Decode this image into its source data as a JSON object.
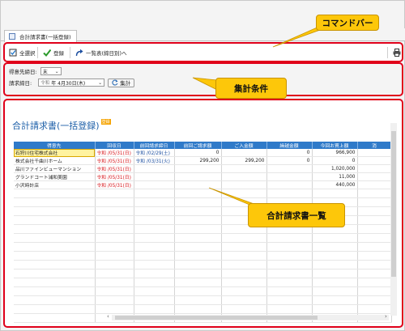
{
  "tab": {
    "label": "合計請求書(一括登録)"
  },
  "toolbar": {
    "select_all": "全選択",
    "register": "登録",
    "list_link": "一覧表(締日別)へ"
  },
  "conditions": {
    "customer_label": "得意先締日:",
    "customer_value": "末",
    "closing_label": "請求締日:",
    "closing_era": "令和",
    "closing_value": "年 4月30日(木)",
    "aggregate_button": "集計"
  },
  "page": {
    "title": "合計請求書(一括登録)",
    "badge": "登録"
  },
  "table": {
    "headers": [
      "得意先",
      "回収日",
      "前回請求締日",
      "前回ご請求額",
      "ご入金額",
      "繰越金額",
      "今回お買上額",
      "消"
    ],
    "rows": [
      [
        "石狩川住宅株式会社",
        "令和 /05/31(日)",
        "令和 /02/29(土)",
        "0",
        "",
        "0",
        "966,900",
        ""
      ],
      [
        "株式会社千曲川ホーム",
        "令和 /05/31(日)",
        "令和 /03/31(火)",
        "299,200",
        "299,200",
        "0",
        "0",
        ""
      ],
      [
        "品川ファインビューマンション",
        "令和 /05/31(日)",
        "",
        "",
        "",
        "",
        "1,020,000",
        ""
      ],
      [
        "グランドコート浦和美園",
        "令和 /05/31(日)",
        "",
        "",
        "",
        "",
        "11,000",
        ""
      ],
      [
        "小沢時計店",
        "令和 /05/31(日)",
        "",
        "",
        "",
        "",
        "440,000",
        ""
      ]
    ]
  },
  "callouts": {
    "command": "コマンドバー",
    "conditions": "集計条件",
    "list": "合計請求書一覧"
  },
  "colors": {
    "annotation_border": "#e0001a",
    "callout_fill": "#fdc70a",
    "header_blue": "#2f7ac9"
  }
}
